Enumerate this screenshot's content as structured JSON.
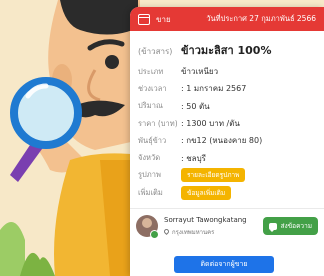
{
  "header": {
    "type_label": "ขาย",
    "date": "วันที่ประกาศ 27 กุมภาพันธ์ 2566",
    "color": "#e53935"
  },
  "title": {
    "prefix": "(ข้าวสาร)",
    "text": "ข้าวมะลิสา 100%"
  },
  "details": [
    {
      "label": "ประเภท",
      "value": "ข้าวเหนียว"
    },
    {
      "label": "ช่วงเวลา",
      "value": ": 1 มกราคม 2567"
    },
    {
      "label": "ปริมาณ",
      "value": ": 50 ตัน"
    },
    {
      "label": "ราคา (บาท)",
      "value": ": 1300 บาท /ตัน"
    },
    {
      "label": "พันธุ์ข้าว",
      "value": ": กข12 (หนองคาย 80)"
    },
    {
      "label": "จังหวัด",
      "value": ": ชลบุรี"
    }
  ],
  "photo": {
    "label": "รูปภาพ",
    "button": "รายละเอียดรูปภาพ"
  },
  "extra": {
    "label": "เพิ่มเติม",
    "button": "ข้อมูลเพิ่มเติม"
  },
  "seller": {
    "name": "Sorrayut Tawongkatang",
    "location": "กรุงเทพมหานคร",
    "chat_label": "ส่งข้อความ",
    "verified_color": "#43a047"
  },
  "contact_button": "ติดต่อจากผู้ขาย",
  "colors": {
    "accent": "#1e73e8",
    "pill": "#f4b400",
    "chat": "#43a047"
  }
}
